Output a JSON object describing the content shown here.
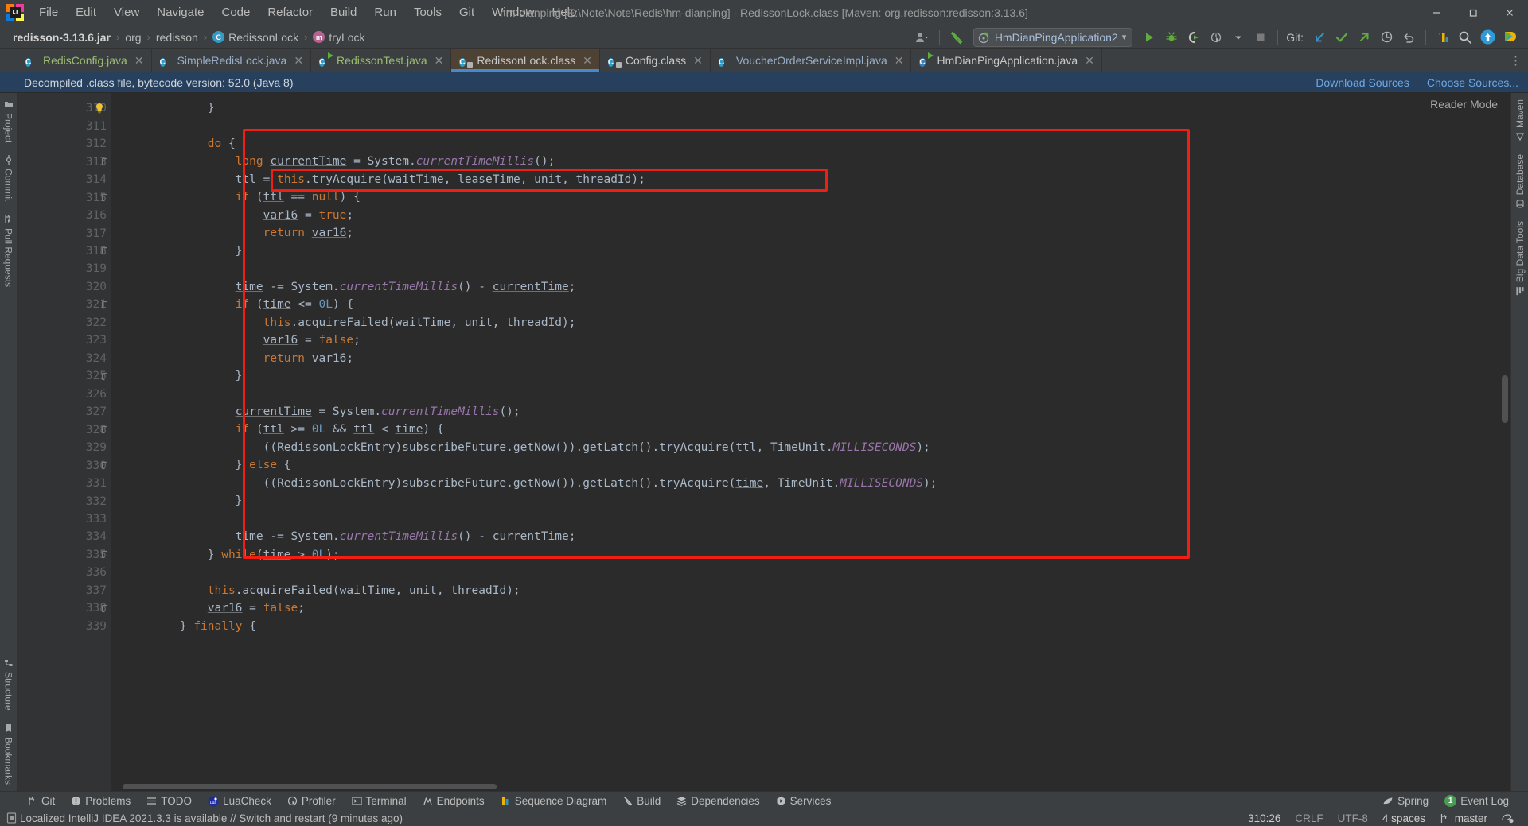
{
  "window": {
    "title": "hm-dianping [E:\\Note\\Note\\Redis\\hm-dianping] - RedissonLock.class [Maven: org.redisson:redisson:3.13.6]",
    "minimize": "—",
    "maximize": "❐",
    "close": "✕"
  },
  "menubar": [
    {
      "label": "File"
    },
    {
      "label": "Edit"
    },
    {
      "label": "View"
    },
    {
      "label": "Navigate"
    },
    {
      "label": "Code"
    },
    {
      "label": "Refactor"
    },
    {
      "label": "Build"
    },
    {
      "label": "Run"
    },
    {
      "label": "Tools"
    },
    {
      "label": "Git"
    },
    {
      "label": "Window"
    },
    {
      "label": "Help"
    }
  ],
  "breadcrumb": {
    "items": [
      {
        "label": "redisson-3.13.6.jar",
        "icon": "jar-icon"
      },
      {
        "label": "org",
        "icon": "folder-icon"
      },
      {
        "label": "redisson",
        "icon": "folder-icon"
      },
      {
        "label": "RedissonLock",
        "icon": "class-icon"
      },
      {
        "label": "tryLock",
        "icon": "method-icon"
      }
    ],
    "separator": "›"
  },
  "toolbar": {
    "run_config": "HmDianPingApplication2",
    "run_config_caret": "▾",
    "buttons": [
      {
        "name": "settings-account-icon"
      },
      {
        "name": "build-hammer-icon"
      },
      {
        "name": "run-icon"
      },
      {
        "name": "debug-icon"
      },
      {
        "name": "run-coverage-icon"
      },
      {
        "name": "profiler-icon"
      },
      {
        "name": "stop-icon"
      }
    ],
    "git_label": "Git:",
    "git_buttons": [
      {
        "name": "git-update-icon"
      },
      {
        "name": "git-commit-icon"
      },
      {
        "name": "git-push-icon"
      },
      {
        "name": "git-history-icon"
      },
      {
        "name": "git-rollback-icon"
      }
    ],
    "right_buttons": [
      {
        "name": "bookmark-stripe-icon"
      },
      {
        "name": "search-everywhere-icon"
      },
      {
        "name": "update-available-icon"
      },
      {
        "name": "ide-features-icon"
      }
    ]
  },
  "tabs": [
    {
      "label": "RedisConfig.java",
      "icon": "java-class-icon",
      "color": "green",
      "active": false,
      "closable": true
    },
    {
      "label": "SimpleRedisLock.java",
      "icon": "java-class-icon",
      "color": "blue",
      "active": false,
      "closable": true
    },
    {
      "label": "RedissonTest.java",
      "icon": "java-test-run-icon",
      "color": "green",
      "active": false,
      "closable": true
    },
    {
      "label": "RedissonLock.class",
      "icon": "java-decompiled-icon",
      "color": "white",
      "active": true,
      "closable": true
    },
    {
      "label": "Config.class",
      "icon": "java-decompiled-icon",
      "color": "white",
      "active": false,
      "closable": true
    },
    {
      "label": "VoucherOrderServiceImpl.java",
      "icon": "java-class-icon",
      "color": "blue",
      "active": false,
      "closable": true
    },
    {
      "label": "HmDianPingApplication.java",
      "icon": "spring-boot-icon",
      "color": "white",
      "active": false,
      "closable": true
    }
  ],
  "tabs_gear": "⋮",
  "notification": {
    "message": "Decompiled .class file, bytecode version: 52.0 (Java 8)",
    "download_sources": "Download Sources",
    "choose_sources": "Choose Sources..."
  },
  "left_stripe": {
    "top": [
      {
        "label": "Project",
        "icon": "project-folder-icon"
      },
      {
        "label": "Commit",
        "icon": "commit-icon"
      },
      {
        "label": "Pull Requests",
        "icon": "pull-request-icon"
      }
    ],
    "bottom": [
      {
        "label": "Structure",
        "icon": "structure-icon"
      },
      {
        "label": "Bookmarks",
        "icon": "bookmark-icon"
      }
    ]
  },
  "right_stripe": {
    "items": [
      {
        "label": "Maven",
        "icon": "maven-icon"
      },
      {
        "label": "Database",
        "icon": "database-icon"
      },
      {
        "label": "Big Data Tools",
        "icon": "big-data-icon"
      }
    ]
  },
  "editor": {
    "reader_mode": "Reader Mode",
    "first_line": 310,
    "line_numbers": [
      310,
      311,
      312,
      313,
      314,
      315,
      316,
      317,
      318,
      319,
      320,
      321,
      322,
      323,
      324,
      325,
      326,
      327,
      328,
      329,
      330,
      331,
      332,
      333,
      334,
      335,
      336,
      337,
      338,
      339
    ],
    "fold_lines": [
      313,
      315,
      318,
      321,
      325,
      328,
      330,
      335,
      338
    ],
    "bulb_line": 310,
    "code_lines": [
      "            }",
      "",
      "            do {",
      "                long currentTime = System.currentTimeMillis();",
      "                ttl = this.tryAcquire(waitTime, leaseTime, unit, threadId);",
      "                if (ttl == null) {",
      "                    var16 = true;",
      "                    return var16;",
      "                }",
      "",
      "                time -= System.currentTimeMillis() - currentTime;",
      "                if (time <= 0L) {",
      "                    this.acquireFailed(waitTime, unit, threadId);",
      "                    var16 = false;",
      "                    return var16;",
      "                }",
      "",
      "                currentTime = System.currentTimeMillis();",
      "                if (ttl >= 0L && ttl < time) {",
      "                    ((RedissonLockEntry)subscribeFuture.getNow()).getLatch().tryAcquire(ttl, TimeUnit.MILLISECONDS);",
      "                } else {",
      "                    ((RedissonLockEntry)subscribeFuture.getNow()).getLatch().tryAcquire(time, TimeUnit.MILLISECONDS);",
      "                }",
      "",
      "                time -= System.currentTimeMillis() - currentTime;",
      "            } while(time > 0L);",
      "",
      "            this.acquireFailed(waitTime, unit, threadId);",
      "            var16 = false;",
      "        } finally {"
    ],
    "annotations": [
      {
        "name": "do-while-block-highlight",
        "color": "#f01e13"
      },
      {
        "name": "try-acquire-line-highlight",
        "color": "#f01e13"
      }
    ]
  },
  "bottom_tools": [
    {
      "label": "Git",
      "icon": "git-branch-icon"
    },
    {
      "label": "Problems",
      "icon": "problems-icon"
    },
    {
      "label": "TODO",
      "icon": "todo-icon"
    },
    {
      "label": "LuaCheck",
      "icon": "luacheck-icon"
    },
    {
      "label": "Profiler",
      "icon": "profiler-icon"
    },
    {
      "label": "Terminal",
      "icon": "terminal-icon"
    },
    {
      "label": "Endpoints",
      "icon": "endpoints-icon"
    },
    {
      "label": "Sequence Diagram",
      "icon": "sequence-diagram-icon"
    },
    {
      "label": "Build",
      "icon": "build-hammer-icon"
    },
    {
      "label": "Dependencies",
      "icon": "dependencies-icon"
    },
    {
      "label": "Services",
      "icon": "services-icon"
    }
  ],
  "bottom_right": {
    "spring": "Spring",
    "event_log": "Event Log",
    "event_log_count": "1"
  },
  "statusbar": {
    "message": "Localized IntelliJ IDEA 2021.3.3 is available // Switch and restart (9 minutes ago)",
    "caret": "310:26",
    "line_separator": "CRLF",
    "encoding": "UTF-8",
    "indent": "4 spaces",
    "branch": "master"
  }
}
